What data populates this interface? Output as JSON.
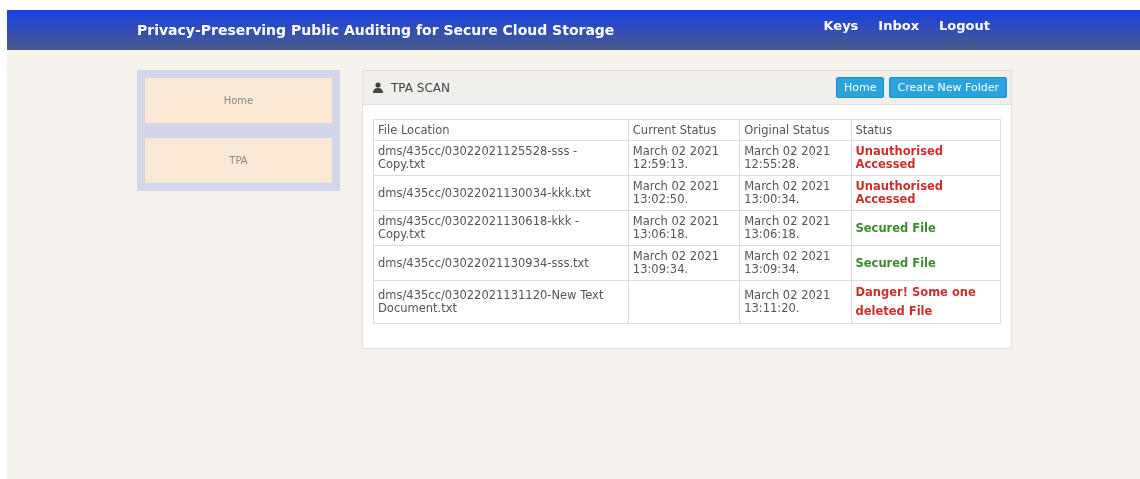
{
  "header": {
    "title": "Privacy-Preserving Public Auditing for Secure Cloud Storage",
    "nav": [
      "Keys",
      "Inbox",
      "Logout"
    ]
  },
  "sidebar": {
    "items": [
      "Home",
      "TPA"
    ]
  },
  "panel": {
    "title": "TPA SCAN",
    "buttons": [
      "Home",
      "Create New Folder"
    ],
    "table": {
      "columns": [
        "File Location",
        "Current Status",
        "Original Status",
        "Status"
      ],
      "rows": [
        {
          "file": "dms/435cc/03022021125528-sss - Copy.txt",
          "current": "March 02 2021 12:59:13.",
          "original": "March 02 2021 12:55:28.",
          "status": "Unauthorised Accessed",
          "kind": "alert"
        },
        {
          "file": "dms/435cc/03022021130034-kkk.txt",
          "current": "March 02 2021 13:02:50.",
          "original": "March 02 2021 13:00:34.",
          "status": "Unauthorised Accessed",
          "kind": "alert"
        },
        {
          "file": "dms/435cc/03022021130618-kkk - Copy.txt",
          "current": "March 02 2021 13:06:18.",
          "original": "March 02 2021 13:06:18.",
          "status": "Secured File",
          "kind": "secure"
        },
        {
          "file": "dms/435cc/03022021130934-sss.txt",
          "current": "March 02 2021 13:09:34.",
          "original": "March 02 2021 13:09:34.",
          "status": "Secured File",
          "kind": "secure"
        },
        {
          "file": "dms/435cc/03022021131120-New Text Document.txt",
          "original": "March 02 2021 13:11:20.",
          "status": "Danger! Some one deleted File",
          "kind": "alert"
        }
      ]
    }
  }
}
